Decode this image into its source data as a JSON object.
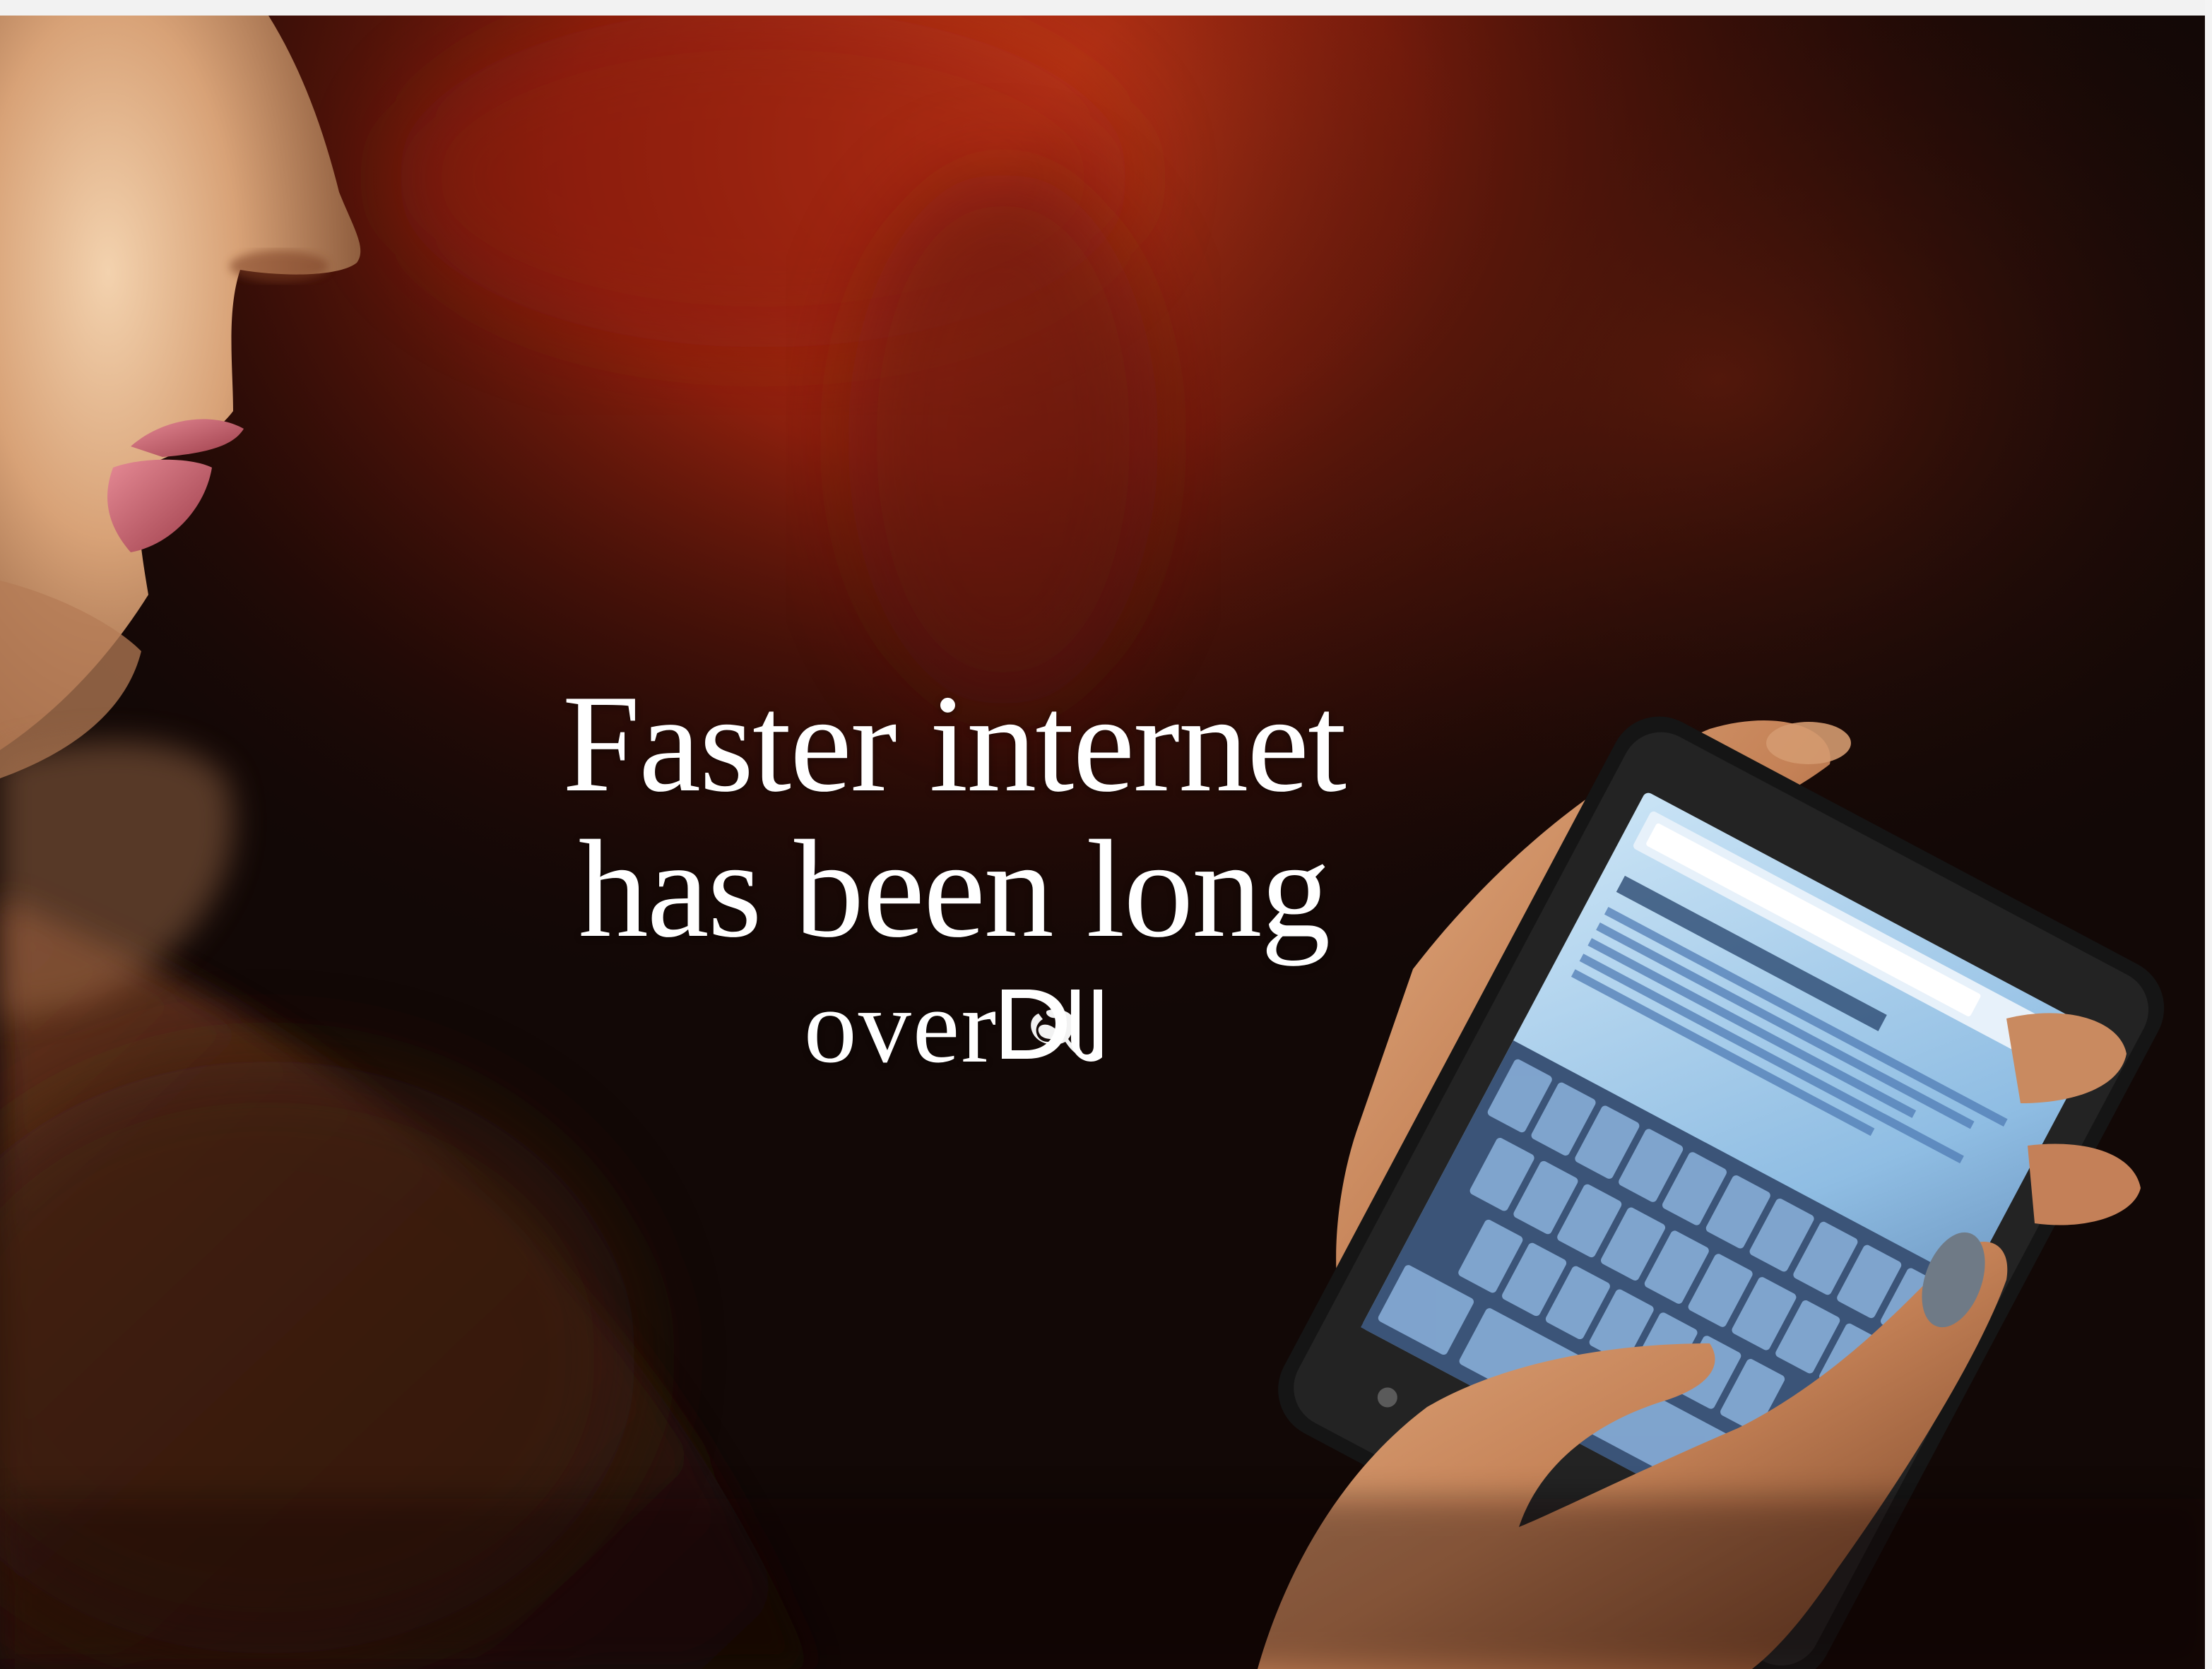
{
  "headline": {
    "line1": "Faster internet",
    "line2": "has been long",
    "line3_prefix": "over"
  },
  "logo": {
    "icon": "logo-mark-icon",
    "lettering": "DU"
  },
  "colors": {
    "text": "#ffffff",
    "background_dark": "#120806",
    "warm_glow": "#c8391a",
    "skin": "#d9a37a",
    "lips": "#c25a63",
    "phone_screen": "#9fc6e8",
    "phone_body": "#161616"
  }
}
